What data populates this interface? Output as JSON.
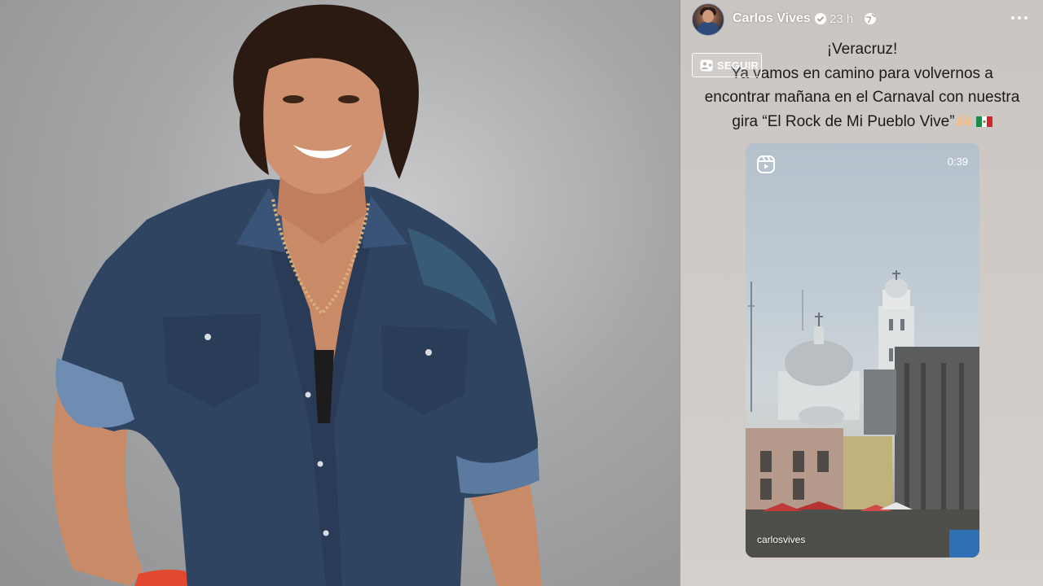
{
  "post": {
    "author": "Carlos Vives",
    "time": "23 h",
    "follow_label": "SEGUIR",
    "caption_lines": [
      "¡Veracruz!",
      "Ya vamos en camino para volvernos a",
      "encontrar mañana en el Carnaval con nuestra",
      "gira “El Rock de Mi Pueblo Vive”"
    ]
  },
  "reel": {
    "duration": "0:39",
    "handle": "carlosvives"
  },
  "icons": {
    "verified": "verified-badge-icon",
    "privacy": "globe-icon",
    "menu": "more-options-icon",
    "follow": "add-friend-icon",
    "reel": "reel-icon",
    "emoji_1": "raised-hands-emoji",
    "emoji_2": "mexico-flag-emoji"
  },
  "colors": {
    "shirt": "#2f4461",
    "panel_bg": "#cfcac6",
    "text": "#1b1b1b"
  }
}
